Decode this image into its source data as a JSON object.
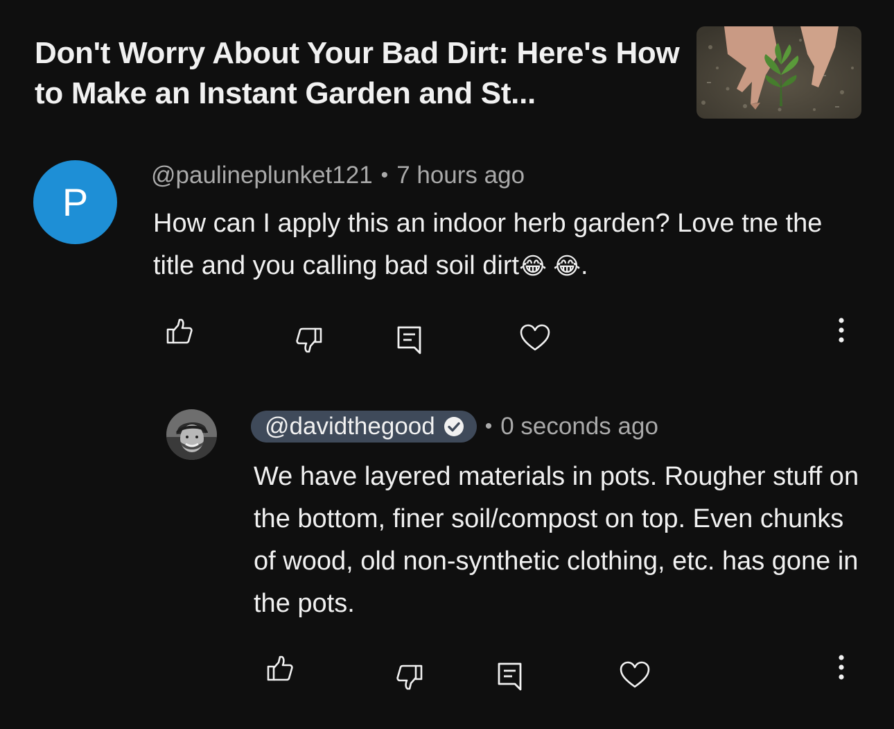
{
  "video": {
    "title": "Don't Worry About Your Bad Dirt: Here's How to Make an Instant Garden and St..."
  },
  "comments": [
    {
      "avatar_letter": "P",
      "handle": "@paulineplunket121",
      "separator": "•",
      "time": "7 hours ago",
      "text": "How can I apply this an indoor herb garden? Love tne the title and you   calling bad soil  dirt",
      "emoji": "😂 😂",
      "text_end": ".",
      "avatar_color": "#1e8fd6"
    },
    {
      "handle": "@davidthegood",
      "verified": true,
      "separator": "•",
      "time": "0 seconds ago",
      "text": "We have layered materials in pots. Rougher stuff on the bottom, finer soil/compost on top. Even chunks of wood, old non-synthetic clothing, etc. has gone in the pots.",
      "handle_pill_color": "#3f4a5a"
    }
  ],
  "actions": {
    "icons": [
      "thumbs-up-icon",
      "thumbs-down-icon",
      "reply-icon",
      "heart-icon",
      "more-options-icon"
    ]
  },
  "colors": {
    "background": "#0f0f0f",
    "primary_text": "#f1f1f1",
    "secondary_text": "#aaaaaa"
  }
}
